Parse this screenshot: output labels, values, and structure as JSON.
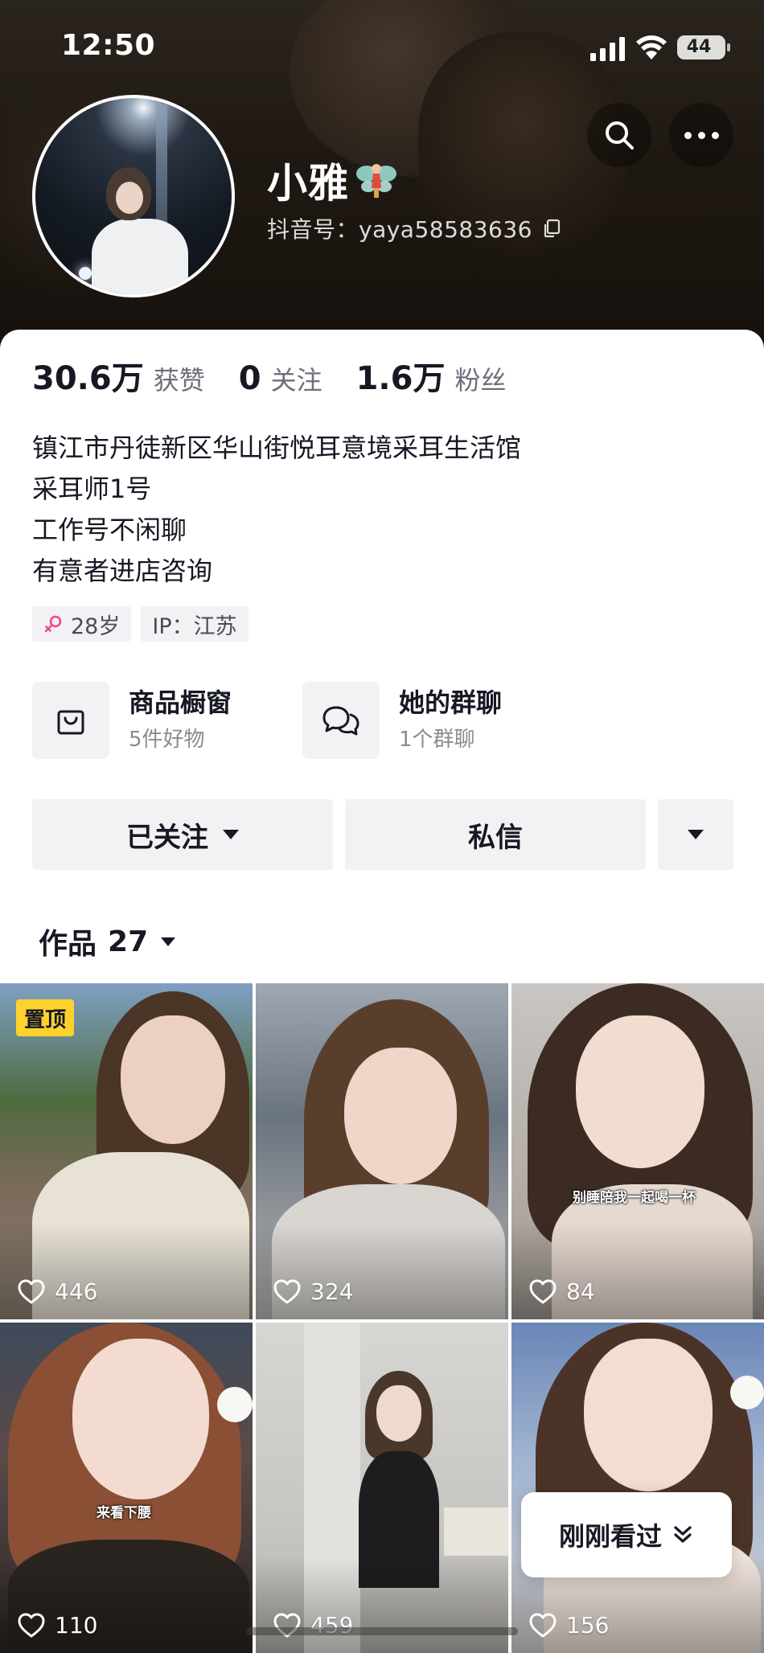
{
  "status_bar": {
    "time": "12:50",
    "battery": "44"
  },
  "profile": {
    "nickname": "小雅",
    "handle": "抖音号：yaya58583636",
    "stats": [
      {
        "value": "30.6万",
        "label": "获赞"
      },
      {
        "value": "0",
        "label": "关注"
      },
      {
        "value": "1.6万",
        "label": "粉丝"
      }
    ],
    "bio": [
      "镇江市丹徒新区华山街悦耳意境采耳生活馆",
      "采耳师1号",
      "工作号不闲聊",
      "有意者进店咨询"
    ],
    "tags": {
      "age": "28岁",
      "ip": "IP：江苏"
    }
  },
  "services": [
    {
      "title": "商品橱窗",
      "subtitle": "5件好物"
    },
    {
      "title": "她的群聊",
      "subtitle": "1个群聊"
    }
  ],
  "actions": {
    "follow": "已关注",
    "message": "私信"
  },
  "works_tab": {
    "label": "作品",
    "count": "27"
  },
  "videos": [
    {
      "likes": "446",
      "badge": "置顶"
    },
    {
      "likes": "324"
    },
    {
      "likes": "84",
      "caption": "别睡陪我一起喝一杯"
    },
    {
      "likes": "110",
      "caption": "来看下腰"
    },
    {
      "likes": "459"
    },
    {
      "likes": "156"
    }
  ],
  "recent_pill": {
    "label": "刚刚看过"
  },
  "colors": {
    "badge": "#fdd22d",
    "text": "#161823",
    "muted": "#6e7079",
    "chip_bg": "#f2f2f4",
    "gender": "#f2488c"
  }
}
